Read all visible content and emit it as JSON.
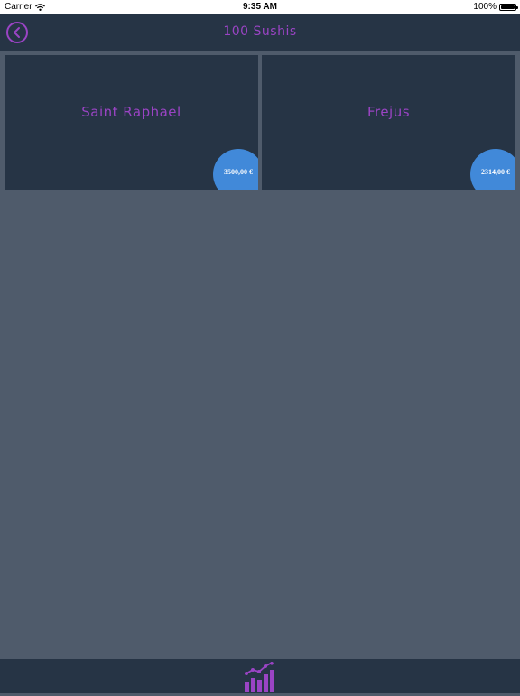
{
  "status_bar": {
    "carrier": "Carrier",
    "time": "9:35 AM",
    "battery": "100%"
  },
  "nav": {
    "title": "100 Sushis",
    "back_icon": "chevron-left-circle-icon"
  },
  "cards": [
    {
      "title": "Saint Raphael",
      "price": "3500,00 €"
    },
    {
      "title": "Frejus",
      "price": "2314,00 €"
    }
  ],
  "tab_bar": {
    "icon": "bar-chart-trend-icon"
  },
  "colors": {
    "accent": "#9a44c4",
    "badge": "#4189d9",
    "panel": "#263445",
    "background": "#4f5b6b"
  }
}
